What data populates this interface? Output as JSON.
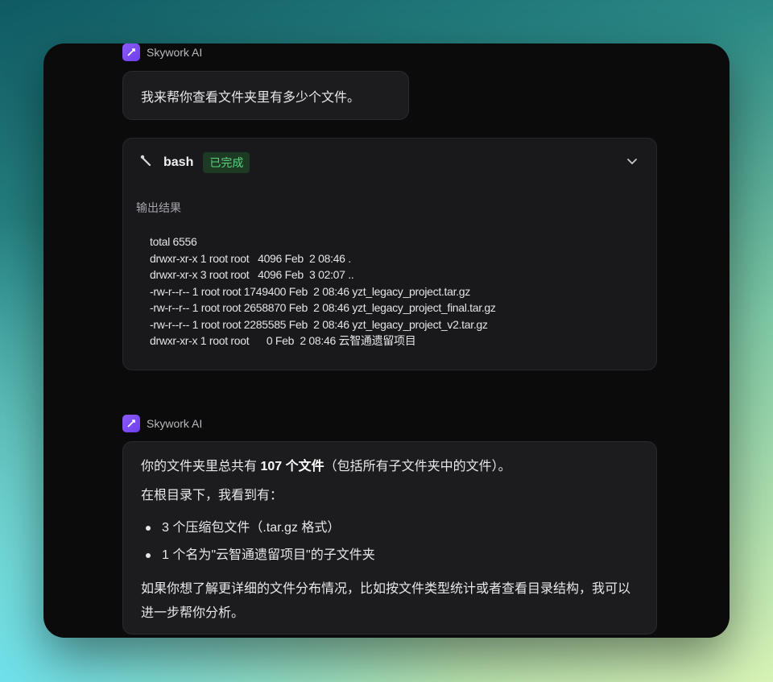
{
  "colors": {
    "accent_purple": "#7c4dff",
    "status_green": "#5ed27d",
    "window_bg": "#0b0b0c"
  },
  "messages": [
    {
      "sender": "Skywork AI",
      "text": "我来帮你查看文件夹里有多少个文件。"
    },
    {
      "sender": "Skywork AI"
    }
  ],
  "tool": {
    "icon": "wrench-icon",
    "name": "bash",
    "status": "已完成",
    "output_label": "输出结果",
    "output_lines": [
      "total 6556",
      "drwxr-xr-x 1 root root   4096 Feb  2 08:46 .",
      "drwxr-xr-x 3 root root   4096 Feb  3 02:07 ..",
      "-rw-r--r-- 1 root root 1749400 Feb  2 08:46 yzt_legacy_project.tar.gz",
      "-rw-r--r-- 1 root root 2658870 Feb  2 08:46 yzt_legacy_project_final.tar.gz",
      "-rw-r--r-- 1 root root 2285585 Feb  2 08:46 yzt_legacy_project_v2.tar.gz",
      "drwxr-xr-x 1 root root      0 Feb  2 08:46 云智通遗留项目"
    ]
  },
  "reply": {
    "line1_pre": "你的文件夹里总共有 ",
    "line1_bold": "107 个文件",
    "line1_post": "（包括所有子文件夹中的文件）。",
    "line2": "在根目录下，我看到有：",
    "bullets": [
      "3 个压缩包文件（.tar.gz 格式）",
      "1 个名为\"云智通遗留项目\"的子文件夹"
    ],
    "final": "如果你想了解更详细的文件分布情况，比如按文件类型统计或者查看目录结构，我可以进一步帮你分析。"
  }
}
